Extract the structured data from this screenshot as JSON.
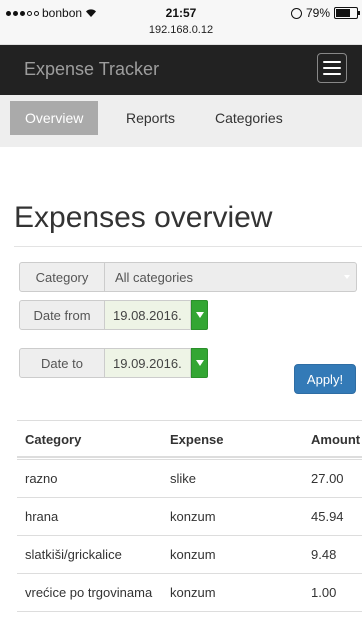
{
  "status_bar": {
    "carrier": "bonbon",
    "time": "21:57",
    "url": "192.168.0.12",
    "battery": "79%",
    "battery_level": 0.79
  },
  "navbar": {
    "brand": "Expense Tracker"
  },
  "tabs": [
    {
      "label": "Overview",
      "active": true
    },
    {
      "label": "Reports",
      "active": false
    },
    {
      "label": "Categories",
      "active": false
    }
  ],
  "page_title": "Expenses overview",
  "filters": {
    "category_label": "Category",
    "category_value": "All categories",
    "date_from_label": "Date from",
    "date_from_value": "19.08.2016.",
    "date_to_label": "Date to",
    "date_to_value": "19.09.2016."
  },
  "apply_label": "Apply!",
  "table": {
    "headers": [
      "Category",
      "Expense",
      "Amount"
    ],
    "rows": [
      [
        "razno",
        "slike",
        "27.00"
      ],
      [
        "hrana",
        "konzum",
        "45.94"
      ],
      [
        "slatkiši/grickalice",
        "konzum",
        "9.48"
      ],
      [
        "vrećice po trgovinama",
        "konzum",
        "1.00"
      ]
    ]
  }
}
